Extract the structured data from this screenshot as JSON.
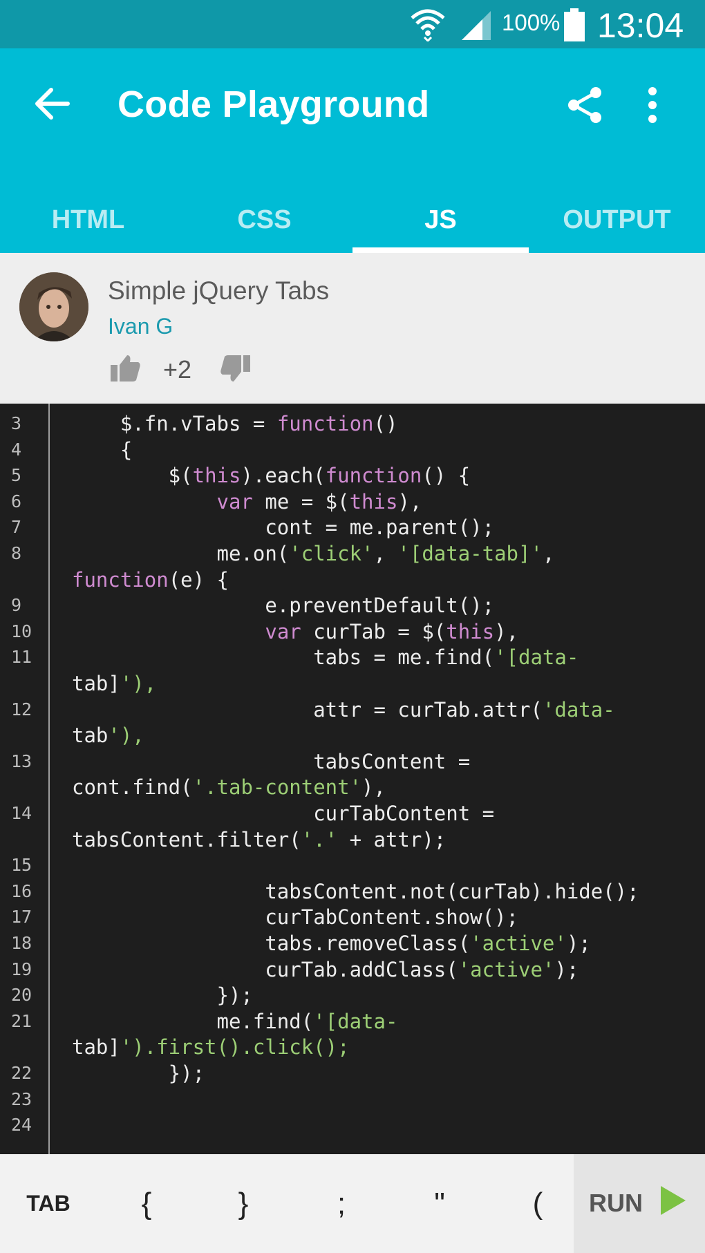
{
  "status_bar": {
    "battery_percent": "100%",
    "time": "13:04",
    "icons": [
      "wifi-icon",
      "signal-icon",
      "battery-icon"
    ]
  },
  "app_bar": {
    "title": "Code Playground",
    "icons": [
      "back-arrow-icon",
      "share-icon",
      "more-vert-icon"
    ]
  },
  "tabs": [
    {
      "label": "HTML",
      "active": false
    },
    {
      "label": "CSS",
      "active": false
    },
    {
      "label": "JS",
      "active": true
    },
    {
      "label": "OUTPUT",
      "active": false
    }
  ],
  "snippet": {
    "title": "Simple jQuery Tabs",
    "author": "Ivan G",
    "votes": "+2"
  },
  "code": {
    "line_numbers": [
      "3",
      "4",
      "5",
      "6",
      "7",
      "8",
      "",
      "9",
      "10",
      "11",
      "",
      "12",
      "",
      "13",
      "",
      "14",
      "",
      "15",
      "16",
      "17",
      "18",
      "19",
      "20",
      "21",
      "",
      "22",
      "23",
      "24"
    ],
    "lines": [
      "    $.fn.vTabs = function()",
      "    {",
      "        $(this).each(function() {",
      "            var me = $(this),",
      "                cont = me.parent();",
      "            me.on('click', '[data-tab]',",
      "function(e) {",
      "                e.preventDefault();",
      "                var curTab = $(this),",
      "                    tabs = me.find('[data-",
      "tab]'),",
      "                    attr = curTab.attr('data-",
      "tab'),",
      "                    tabsContent =",
      "cont.find('.tab-content'),",
      "                    curTabContent =",
      "tabsContent.filter('.' + attr);",
      "",
      "                tabsContent.not(curTab).hide();",
      "                curTabContent.show();",
      "                tabs.removeClass('active');",
      "                curTab.addClass('active');",
      "            });",
      "            me.find('[data-",
      "tab]').first().click();",
      "        });",
      "",
      ""
    ],
    "colors": {
      "keyword": "#cf8bd0",
      "string": "#9dcf76",
      "text": "#ececec"
    }
  },
  "keybar": {
    "keys": [
      "TAB",
      "{",
      "}",
      ";",
      "\"",
      "("
    ],
    "run_label": "RUN"
  },
  "colors": {
    "accent": "#00bcd5",
    "status": "#0f98a8",
    "run_play": "#7cc243"
  }
}
